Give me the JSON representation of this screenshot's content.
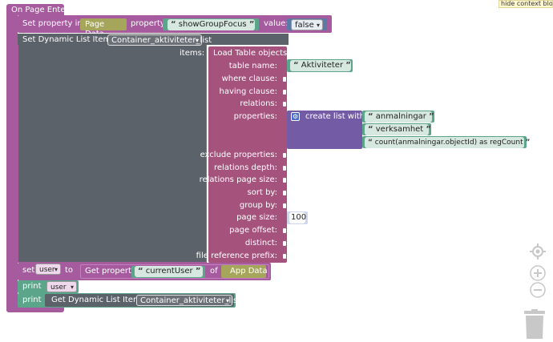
{
  "top_hint": "hide context block",
  "event": {
    "title": "On Page Enter"
  },
  "set_property": {
    "prefix": "Set property in:",
    "target": "Page Data",
    "property_label": "property:",
    "property_value": "showGroupFocus",
    "value_label": "value:",
    "value": "false"
  },
  "set_list": {
    "label": "Set Dynamic List Items to",
    "list_name": "Container_aktiviteter_list",
    "items_label": "items:"
  },
  "load_table": {
    "title": "Load Table objects",
    "params": {
      "table_name": "table name:",
      "where_clause": "where clause:",
      "having_clause": "having clause:",
      "relations": "relations:",
      "properties": "properties:",
      "exclude_properties": "exclude properties:",
      "relations_depth": "relations depth:",
      "relations_page_size": "relations page size:",
      "sort_by": "sort by:",
      "group_by": "group by:",
      "page_size": "page size:",
      "page_offset": "page offset:",
      "distinct": "distinct:",
      "file_reference_prefix": "file reference prefix:"
    },
    "table_name_value": "Aktiviteter",
    "page_size_value": "100"
  },
  "create_list": {
    "label": "create list with",
    "items": [
      "anmalningar",
      "verksamhet",
      "count(anmalningar.objectId) as regCount"
    ]
  },
  "set_user": {
    "set_label": "set",
    "var_name": "user",
    "to_label": "to",
    "get_property_label": "Get property",
    "property_value": "currentUser",
    "of_label": "of",
    "source": "App Data"
  },
  "print1": {
    "label": "print",
    "var": "user"
  },
  "print2": {
    "label": "print",
    "get_label": "Get Dynamic List Items of",
    "list_name": "Container_aktiviteter_list"
  },
  "quote": "“",
  "quote_close": "”",
  "colors": {
    "event": "#a55b9e",
    "load_table": "#a5537d",
    "dark_block": "#5c6269",
    "string": "#5ba58b",
    "list": "#745ba5",
    "page_data": "#a5a55b",
    "number": "#cfd6ec",
    "print": "#5ba58b"
  }
}
